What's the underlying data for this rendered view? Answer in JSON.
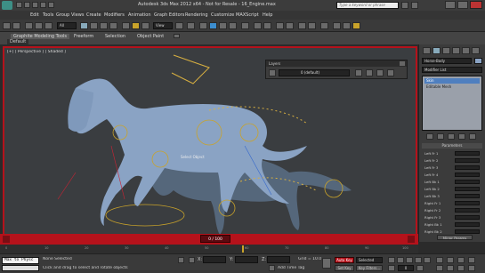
{
  "app": {
    "title": "Autodesk 3ds Max 2012 x64 - Not for Resale - 16_Engine.max",
    "search_placeholder": "Type a keyword or phrase"
  },
  "menu": [
    "Edit",
    "Tools",
    "Group",
    "Views",
    "Create",
    "Modifiers",
    "Animation",
    "Graph Editors",
    "Rendering",
    "Customize",
    "MAXScript",
    "Help"
  ],
  "toolbar": {
    "selection_filter": "All",
    "view_dropdown": "View"
  },
  "ribbon": {
    "tabs": [
      "Graphite Modeling Tools",
      "Freeform",
      "Selection",
      "Object Paint"
    ],
    "default_label": "Default"
  },
  "viewport": {
    "label": "[+] [ Perspective ] [ Shaded ]",
    "tooltip_text": "Select Object"
  },
  "layer_window": {
    "title": "Layers",
    "layer_name": "0 (default)"
  },
  "command_panel": {
    "object_name": "Horse-Body",
    "modifier_list": "Modifier List",
    "stack_items": [
      "Skin",
      "Editable Mesh"
    ],
    "params_header": "Parameters",
    "param_rows": [
      "Left Fr 1",
      "Left Fr 2",
      "Left Fr 3",
      "Left Fr 4",
      "Left Bk 1",
      "Left Bk 2",
      "Left Bk 3",
      "Right Fr 1",
      "Right Fr 2",
      "Right Fr 3",
      "Right Bk 1",
      "Right Bk 2"
    ],
    "mirror_label": "Mirror Params"
  },
  "timeline": {
    "frame_display": "0 / 100"
  },
  "trackbar": {
    "ticks": [
      "0",
      "10",
      "20",
      "30",
      "40",
      "50",
      "60",
      "70",
      "80",
      "90",
      "100"
    ]
  },
  "status": {
    "listener_text": "Max to Physc",
    "selected": "None Selected",
    "prompt": "Click and drag to select and rotate objects",
    "x_label": "X:",
    "x_value": "",
    "y_label": "Y:",
    "y_value": "",
    "z_label": "Z:",
    "z_value": "",
    "grid": "Grid = 10.0",
    "add_time_tag": "Add Time Tag",
    "auto_key": "Auto Key",
    "set_key_dropdown": "Selected",
    "set_key": "Set Key",
    "key_filters": "Key Filters...",
    "frame_field": "0"
  }
}
